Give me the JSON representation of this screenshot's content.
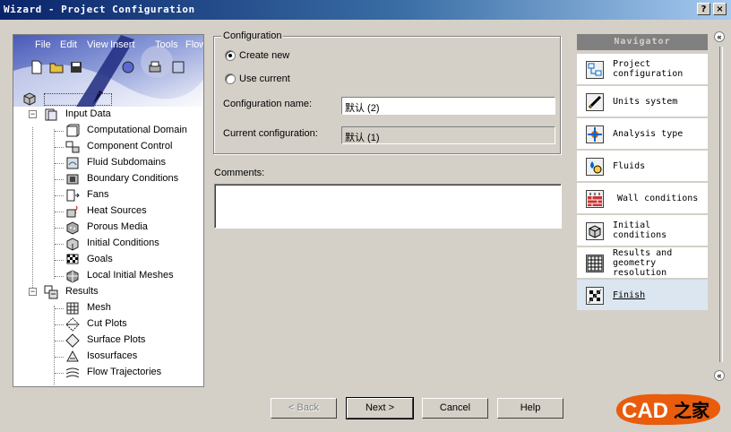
{
  "window": {
    "title": "Wizard - Project Configuration",
    "help_btn": "?",
    "close_btn": "×"
  },
  "banner_menu": [
    "File",
    "Edit",
    "View",
    "Insert",
    "Tools",
    "Flow"
  ],
  "tree": {
    "root_label": "",
    "input_data": {
      "label": "Input Data",
      "children": [
        "Computational Domain",
        "Component Control",
        "Fluid Subdomains",
        "Boundary Conditions",
        "Fans",
        "Heat Sources",
        "Porous Media",
        "Initial Conditions",
        "Goals",
        "Local Initial Meshes"
      ]
    },
    "results": {
      "label": "Results",
      "children": [
        "Mesh",
        "Cut Plots",
        "Surface Plots",
        "Isosurfaces",
        "Flow Trajectories"
      ]
    },
    "expander_minus": "−"
  },
  "config": {
    "group_label": "Configuration",
    "create_new": "Create new",
    "use_current": "Use current",
    "name_label": "Configuration name:",
    "name_value": "默认 (2)",
    "current_label": "Current configuration:",
    "current_value": "默认 (1)",
    "comments_label": "Comments:",
    "comments_value": ""
  },
  "buttons": {
    "back": "< Back",
    "next": "Next >",
    "cancel": "Cancel",
    "help": "Help"
  },
  "navigator": {
    "title": "Navigator",
    "items": [
      {
        "label": "Project\nconfiguration"
      },
      {
        "label": "Units system"
      },
      {
        "label": "Analysis type"
      },
      {
        "label": "Fluids"
      },
      {
        "label": "Wall conditions"
      },
      {
        "label": "Initial\nconditions"
      },
      {
        "label": "Results and\ngeometry\nresolution"
      },
      {
        "label": "Finish"
      }
    ],
    "collapse_glyph": "«"
  },
  "watermark": {
    "text_main": "CAD",
    "text_cn": "之家"
  }
}
